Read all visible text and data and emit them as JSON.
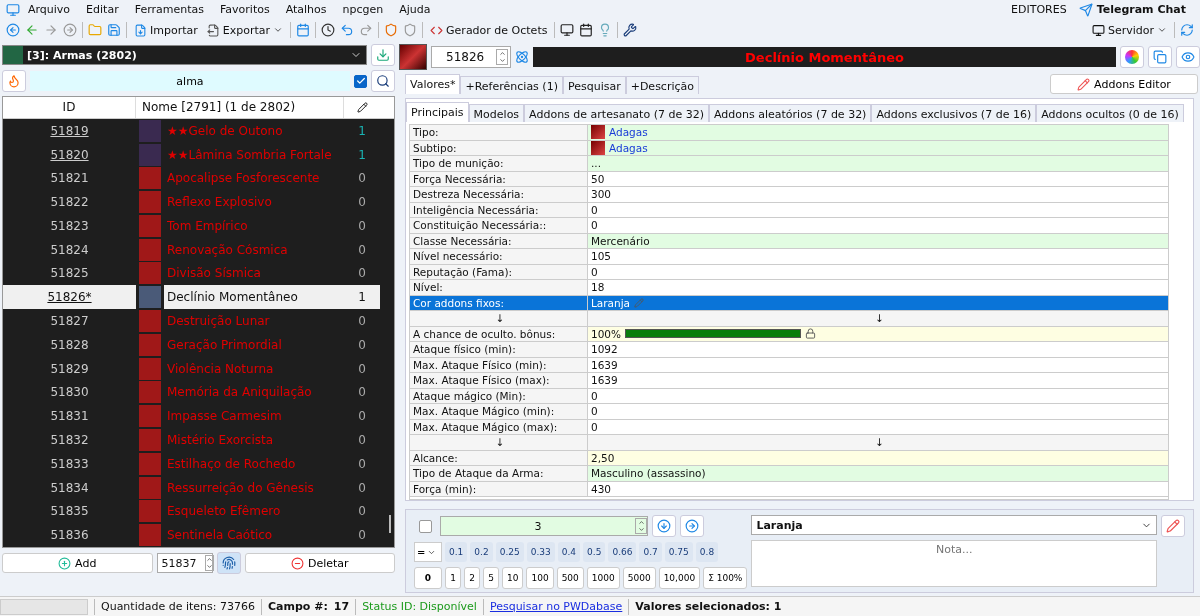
{
  "menu": [
    "Arquivo",
    "Editar",
    "Ferramentas",
    "Favoritos",
    "Atalhos",
    "npcgen",
    "Ajuda"
  ],
  "menu_right": {
    "editors": "EDITORES",
    "telegram": "Telegram Chat"
  },
  "toolbar": {
    "import": "Importar",
    "export": "Exportar",
    "octets": "Gerador de Octets",
    "server": "Servidor"
  },
  "category": "[3]: Armas (2802)",
  "search": {
    "value": "alma",
    "checked": true
  },
  "list": {
    "columns": [
      "ID",
      "Nome [2791] (1 de 2802)"
    ],
    "rows": [
      {
        "id": "51819",
        "name": "★★Gelo de Outono",
        "count": "1",
        "modified": true,
        "selected": false,
        "color": "#3a2a50"
      },
      {
        "id": "51820",
        "name": "★★Lâmina Sombria Fortale",
        "count": "1",
        "modified": true,
        "selected": false,
        "color": "#3a2a50"
      },
      {
        "id": "51821",
        "name": "Apocalipse Fosforescente",
        "count": "0",
        "modified": false,
        "selected": false,
        "color": "#a01818"
      },
      {
        "id": "51822",
        "name": "Reflexo Explosivo",
        "count": "0",
        "modified": false,
        "selected": false,
        "color": "#a01818"
      },
      {
        "id": "51823",
        "name": "Tom Empírico",
        "count": "0",
        "modified": false,
        "selected": false,
        "color": "#a01818"
      },
      {
        "id": "51824",
        "name": "Renovação Cósmica",
        "count": "0",
        "modified": false,
        "selected": false,
        "color": "#a01818"
      },
      {
        "id": "51825",
        "name": "Divisão Sísmica",
        "count": "0",
        "modified": false,
        "selected": false,
        "color": "#a01818"
      },
      {
        "id": "51826*",
        "name": "Declínio Momentâneo",
        "count": "1",
        "modified": true,
        "selected": true,
        "color": "#4a5a78"
      },
      {
        "id": "51827",
        "name": "Destruição Lunar",
        "count": "0",
        "modified": false,
        "selected": false,
        "color": "#a01818"
      },
      {
        "id": "51828",
        "name": "Geração Primordial",
        "count": "0",
        "modified": false,
        "selected": false,
        "color": "#a01818"
      },
      {
        "id": "51829",
        "name": "Violência Noturna",
        "count": "0",
        "modified": false,
        "selected": false,
        "color": "#a01818"
      },
      {
        "id": "51830",
        "name": "Memória da Aniquilação",
        "count": "0",
        "modified": false,
        "selected": false,
        "color": "#a01818"
      },
      {
        "id": "51831",
        "name": "Impasse Carmesim",
        "count": "0",
        "modified": false,
        "selected": false,
        "color": "#a01818"
      },
      {
        "id": "51832",
        "name": "Mistério Exorcista",
        "count": "0",
        "modified": false,
        "selected": false,
        "color": "#a01818"
      },
      {
        "id": "51833",
        "name": "Estilhaço de Rochedo",
        "count": "0",
        "modified": false,
        "selected": false,
        "color": "#a01818"
      },
      {
        "id": "51834",
        "name": "Ressurreição do Gênesis",
        "count": "0",
        "modified": false,
        "selected": false,
        "color": "#a01818"
      },
      {
        "id": "51835",
        "name": "Esqueleto Efêmero",
        "count": "0",
        "modified": false,
        "selected": false,
        "color": "#a01818"
      },
      {
        "id": "51836",
        "name": "Sentinela Caótico",
        "count": "0",
        "modified": false,
        "selected": false,
        "color": "#a01818"
      }
    ]
  },
  "list_footer": {
    "add": "Add",
    "next_id": "51837",
    "delete": "Deletar"
  },
  "item": {
    "id": "51826",
    "title": "Declínio Momentâneo"
  },
  "tabs": [
    {
      "label": "Valores*",
      "selected": true
    },
    {
      "label": "+Referências (1)",
      "selected": false
    },
    {
      "label": "Pesquisar",
      "selected": false
    },
    {
      "label": "+Descrição",
      "selected": false
    }
  ],
  "addons_editor": "Addons Editor",
  "subtabs": [
    {
      "label": "Principais",
      "selected": true
    },
    {
      "label": "Modelos",
      "selected": false
    },
    {
      "label": "Addons de artesanato (7 de 32)",
      "selected": false
    },
    {
      "label": "Addons aleatórios (7 de 32)",
      "selected": false
    },
    {
      "label": "Addons exclusivos (7 de 16)",
      "selected": false
    },
    {
      "label": "Addons ocultos (0 de 16)",
      "selected": false
    }
  ],
  "properties": [
    {
      "kind": "list",
      "label": "Tipo:",
      "value": "Adagas",
      "icon": true,
      "selected": false
    },
    {
      "kind": "list",
      "label": "Subtipo:",
      "value": "Adagas",
      "icon": true,
      "selected": false
    },
    {
      "kind": "list",
      "label": "Tipo de munição:",
      "value": "...",
      "selected": false
    },
    {
      "kind": "plain",
      "label": "Força Necessária:",
      "value": "50",
      "selected": false
    },
    {
      "kind": "plain",
      "label": "Destreza Necessária:",
      "value": "300",
      "selected": false
    },
    {
      "kind": "plain",
      "label": "Inteligência Necessária:",
      "value": "0",
      "selected": false
    },
    {
      "kind": "plain",
      "label": "Constituição Necessária::",
      "value": "0",
      "selected": false
    },
    {
      "kind": "list",
      "label": "Classe Necessária:",
      "value": "Mercenário",
      "selected": false
    },
    {
      "kind": "plain",
      "label": "Nível necessário:",
      "value": "105",
      "selected": false
    },
    {
      "kind": "plain",
      "label": "Reputação (Fama):",
      "value": "0",
      "selected": false
    },
    {
      "kind": "plain",
      "label": "Nível:",
      "value": "18",
      "selected": false
    },
    {
      "kind": "list",
      "label": "Cor addons fixos:",
      "value": "Laranja",
      "selected": true
    },
    {
      "kind": "separator",
      "label": "↓",
      "value": "↓",
      "selected": false
    },
    {
      "kind": "bar",
      "label": "A chance de oculto. bônus:",
      "value": "100%",
      "level": 1,
      "selected": false
    },
    {
      "kind": "plain",
      "label": "Ataque físico (min):",
      "value": "1092",
      "selected": false
    },
    {
      "kind": "plain",
      "label": "Max. Ataque Físico (min):",
      "value": "1639",
      "selected": false
    },
    {
      "kind": "plain",
      "label": "Max. Ataque Físico (max):",
      "value": "1639",
      "selected": false
    },
    {
      "kind": "plain",
      "label": "Ataque mágico (Min):",
      "value": "0",
      "selected": false
    },
    {
      "kind": "plain",
      "label": "Max. Ataque Mágico (min):",
      "value": "0",
      "selected": false
    },
    {
      "kind": "plain",
      "label": "Max. Ataque Mágico (max):",
      "value": "0",
      "selected": false
    },
    {
      "kind": "separator",
      "label": "↓",
      "value": "↓",
      "selected": false
    },
    {
      "kind": "float",
      "label": "Alcance:",
      "value": "2,50",
      "selected": false
    },
    {
      "kind": "list",
      "label": "Tipo de Ataque da Arma:",
      "value": "Masculino (assassino)",
      "selected": false
    },
    {
      "kind": "plain",
      "label": "Força (min):",
      "value": "430",
      "selected": false
    }
  ],
  "editor": {
    "checked": false,
    "value": "3",
    "operator": "=",
    "choice": "Laranja",
    "note_placeholder": "Nota...",
    "factors": [
      "0.1",
      "0.2",
      "0.25",
      "0.33",
      "0.4",
      "0.5",
      "0.66",
      "0.7",
      "0.75",
      "0.8"
    ],
    "amounts": [
      "0",
      "1",
      "2",
      "5",
      "10",
      "100",
      "500",
      "1000",
      "5000",
      "10,000",
      "Σ 100%"
    ]
  },
  "status_bar": {
    "count": "Quantidade de itens: 73766",
    "field_label": "Campo #:",
    "field": "17",
    "status": "Status ID: Disponível",
    "link": "Pesquisar no PWDabase",
    "selection": "Valores selecionados: 1"
  }
}
